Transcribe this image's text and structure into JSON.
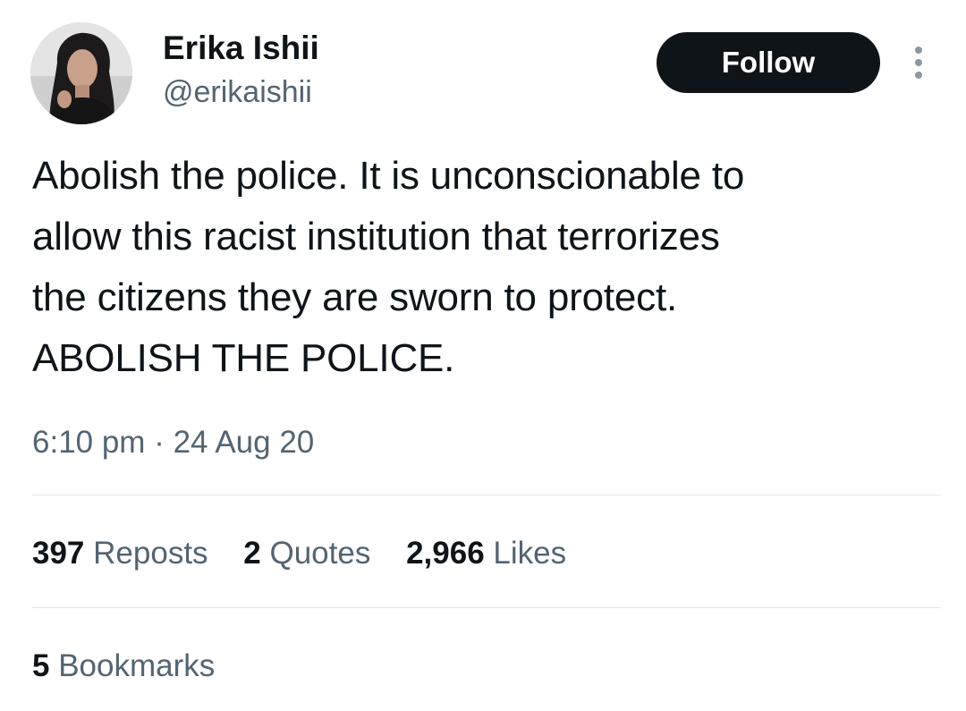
{
  "author": {
    "display_name": "Erika Ishii",
    "handle": "@erikaishii"
  },
  "follow_label": "Follow",
  "tweet": {
    "lines": [
      "Abolish the police. It is unconscionable to",
      "allow this racist institution that terrorizes",
      "the citizens they are sworn to protect.",
      "ABOLISH THE POLICE."
    ],
    "time": "6:10 pm",
    "separator": "·",
    "date": "24 Aug 20"
  },
  "stats": {
    "reposts": {
      "count": "397",
      "label": "Reposts"
    },
    "quotes": {
      "count": "2",
      "label": "Quotes"
    },
    "likes": {
      "count": "2,966",
      "label": "Likes"
    },
    "bookmarks": {
      "count": "5",
      "label": "Bookmarks"
    }
  },
  "icons": {
    "more": "more-vertical-icon",
    "avatar": "user-avatar"
  },
  "colors": {
    "text": "#0f1419",
    "secondary": "#536471",
    "button_bg": "#0f1419",
    "button_text": "#ffffff",
    "divider": "#e1e6ea"
  }
}
